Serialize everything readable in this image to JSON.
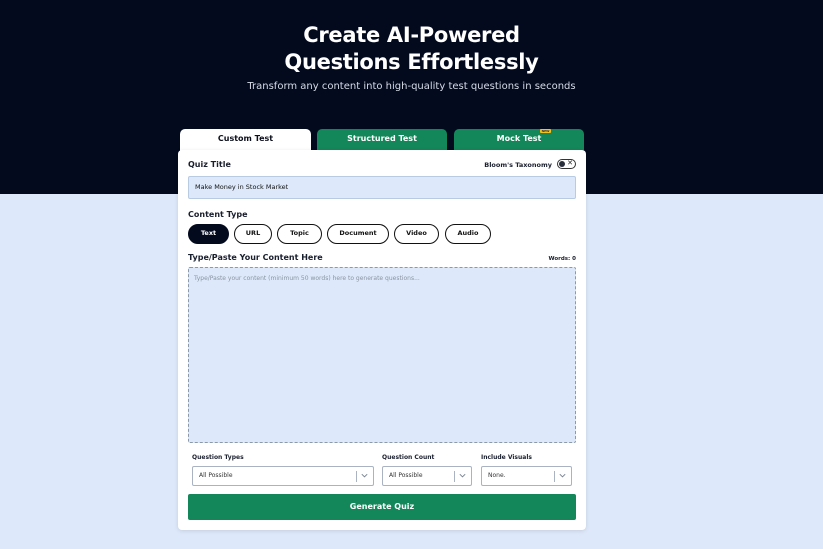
{
  "hero": {
    "title_line1": "Create AI-Powered",
    "title_line2": "Questions Effortlessly",
    "subtitle": "Transform any content into high-quality test questions in seconds"
  },
  "tabs": [
    {
      "label": "Custom Test",
      "active": true
    },
    {
      "label": "Structured Test",
      "active": false
    },
    {
      "label": "Mock Test",
      "active": false,
      "badge": "NEW"
    }
  ],
  "form": {
    "quiz_title_label": "Quiz Title",
    "blooms_label": "Bloom's Taxonomy",
    "blooms_toggle_symbol": "✕",
    "quiz_title_value": "Make Money in Stock Market",
    "content_type_label": "Content Type",
    "content_types": [
      "Text",
      "URL",
      "Topic",
      "Document",
      "Video",
      "Audio"
    ],
    "content_type_selected": "Text",
    "content_label": "Type/Paste Your Content Here",
    "words_count": "Words: 0",
    "content_placeholder": "Type/Paste your content (minimum 50 words) here to generate questions...",
    "question_types_label": "Question Types",
    "question_types_value": "All Possible",
    "question_count_label": "Question Count",
    "question_count_value": "All Possible",
    "include_visuals_label": "Include Visuals",
    "include_visuals_value": "None.",
    "generate_label": "Generate Quiz"
  },
  "colors": {
    "hero_bg": "#030a1e",
    "page_bg": "#dde9fa",
    "accent_green": "#14875a",
    "badge_yellow": "#f4c21d"
  }
}
